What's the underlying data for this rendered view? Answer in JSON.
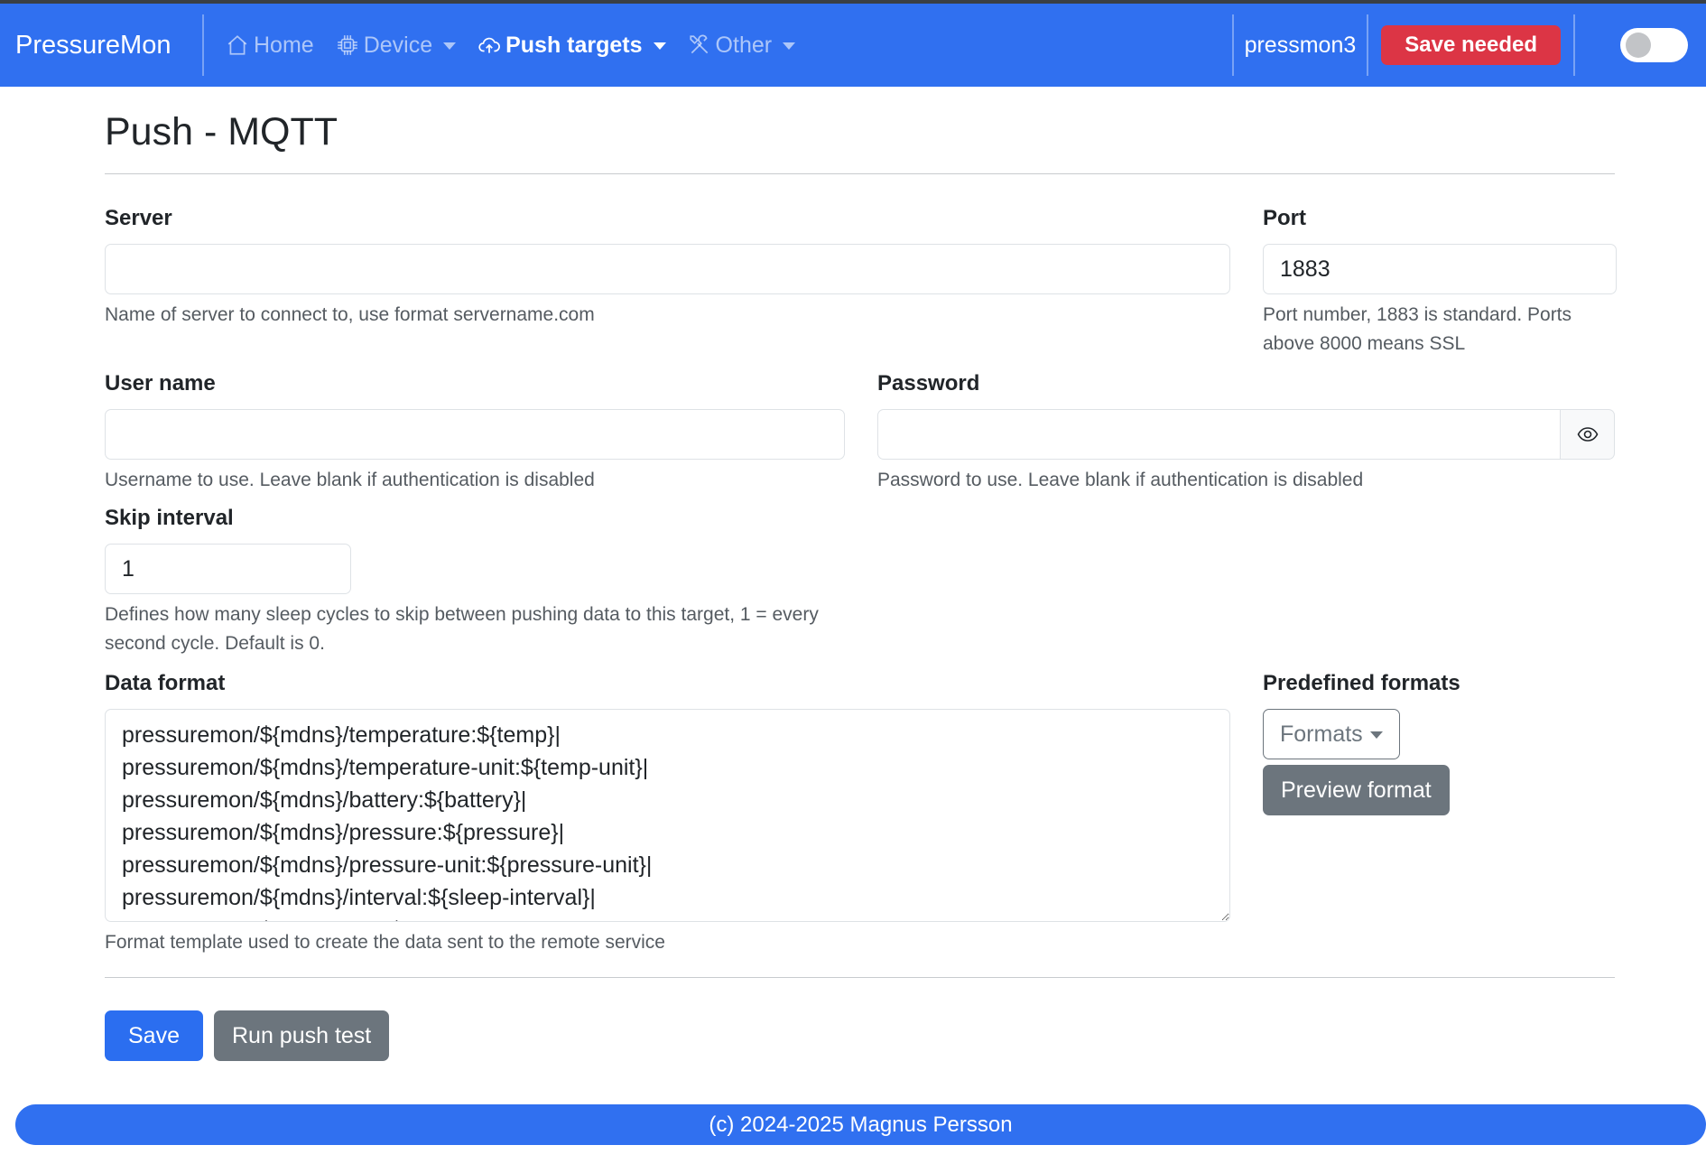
{
  "navbar": {
    "brand": "PressureMon",
    "items": [
      {
        "label": "Home",
        "icon": "home-icon",
        "dropdown": false,
        "active": false
      },
      {
        "label": "Device",
        "icon": "chip-icon",
        "dropdown": true,
        "active": false
      },
      {
        "label": "Push targets",
        "icon": "cloud-upload-icon",
        "dropdown": true,
        "active": true
      },
      {
        "label": "Other",
        "icon": "tools-icon",
        "dropdown": true,
        "active": false
      }
    ],
    "hostname": "pressmon3",
    "save_badge": "Save needed",
    "theme_toggle": "off"
  },
  "page": {
    "title": "Push - MQTT"
  },
  "form": {
    "server": {
      "label": "Server",
      "value": "",
      "help": "Name of server to connect to, use format servername.com"
    },
    "port": {
      "label": "Port",
      "value": "1883",
      "help": "Port number, 1883 is standard. Ports above 8000 means SSL"
    },
    "username": {
      "label": "User name",
      "value": "",
      "help": "Username to use. Leave blank if authentication is disabled"
    },
    "password": {
      "label": "Password",
      "value": "",
      "help": "Password to use. Leave blank if authentication is disabled"
    },
    "skip_interval": {
      "label": "Skip interval",
      "value": "1",
      "help": "Defines how many sleep cycles to skip between pushing data to this target, 1 = every second cycle. Default is 0."
    },
    "data_format": {
      "label": "Data format",
      "value": "pressuremon/${mdns}/temperature:${temp}|\npressuremon/${mdns}/temperature-unit:${temp-unit}|\npressuremon/${mdns}/battery:${battery}|\npressuremon/${mdns}/pressure:${pressure}|\npressuremon/${mdns}/pressure-unit:${pressure-unit}|\npressuremon/${mdns}/interval:${sleep-interval}|\npressuremon/${mdns}/rssi:${rssi}|",
      "help": "Format template used to create the data sent to the remote service"
    },
    "predefined": {
      "label": "Predefined formats",
      "formats_button": "Formats",
      "preview_button": "Preview format"
    }
  },
  "actions": {
    "save": "Save",
    "push_test": "Run push test"
  },
  "footer": {
    "text": "(c) 2024-2025 Magnus Persson"
  },
  "colors": {
    "navbar": "#3070f0",
    "danger": "#dc3545",
    "primary": "#2b6ef0",
    "secondary": "#6c757d"
  }
}
